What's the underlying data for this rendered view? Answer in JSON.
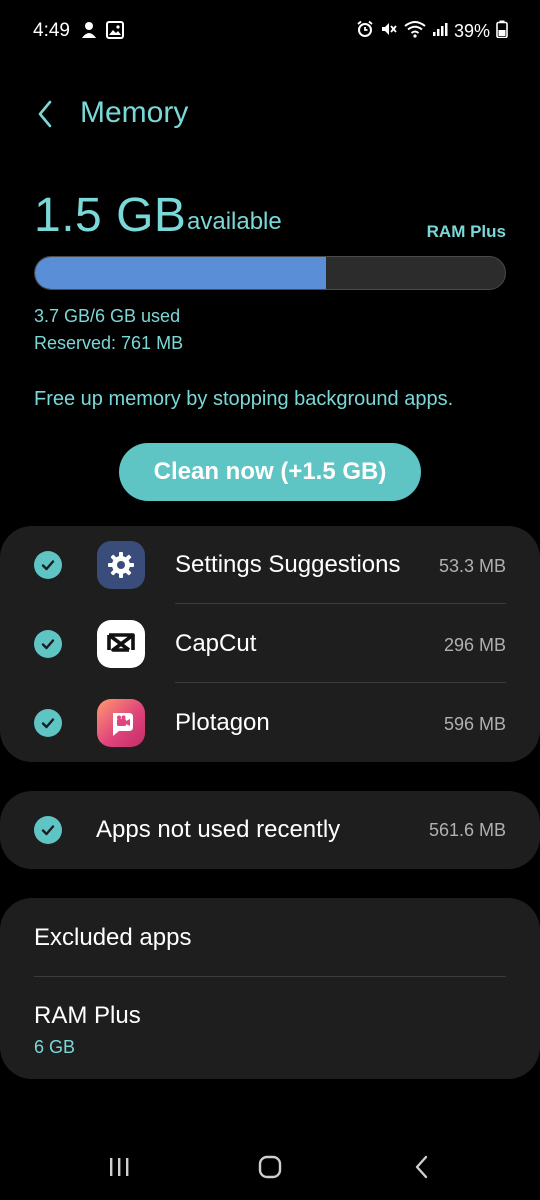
{
  "status_bar": {
    "time": "4:49",
    "battery": "39%",
    "left_icons": [
      "notification-icon",
      "gallery-icon"
    ],
    "right_icons": [
      "alarm-icon",
      "mute-icon",
      "wifi-icon",
      "signal-icon",
      "battery-icon"
    ]
  },
  "header": {
    "title": "Memory"
  },
  "memory": {
    "available_value": "1.5 GB",
    "available_label": "available",
    "ram_plus_link": "RAM Plus",
    "used_fraction": 0.62,
    "used_text": "3.7 GB/6 GB used",
    "reserved_text": "Reserved: 761 MB",
    "hint": "Free up memory by stopping background apps.",
    "clean_button": "Clean now (+1.5 GB)"
  },
  "apps": [
    {
      "name": "Settings Suggestions",
      "size": "53.3 MB",
      "icon": "settings-gear-icon",
      "checked": true
    },
    {
      "name": "CapCut",
      "size": "296 MB",
      "icon": "capcut-icon",
      "checked": true
    },
    {
      "name": "Plotagon",
      "size": "596 MB",
      "icon": "plotagon-icon",
      "checked": true
    }
  ],
  "recent": {
    "label": "Apps not used recently",
    "size": "561.6 MB",
    "checked": true
  },
  "excluded": {
    "excluded_label": "Excluded apps",
    "ram_plus_label": "RAM Plus",
    "ram_plus_value": "6 GB"
  },
  "nav": {
    "icons": [
      "recents-icon",
      "home-icon",
      "back-icon"
    ]
  },
  "colors": {
    "accent": "#7ad8d8",
    "button": "#5ec4c4",
    "bar_fill": "#5a8ed6",
    "card": "#1e1e1e",
    "background": "#000000"
  }
}
